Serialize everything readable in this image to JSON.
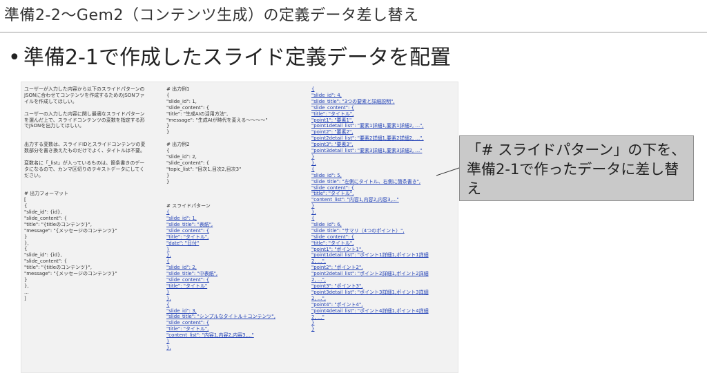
{
  "header": {
    "title": "準備2-2〜Gem2（コンテンツ生成）の定義データ差し替え"
  },
  "bullet": {
    "marker": "•",
    "text": "準備2-1で作成したスライド定義データを配置"
  },
  "document": {
    "col1": [
      "ユーザーが入力した内容から以下のスライドパターンの",
      "JSONに合わせてコンテンツを作成するためのJSONファ",
      "イルを作成してほしい。",
      "",
      "ユーザーの入力した内容に関し最適なスライドパターン",
      "を選んだ上で、スライドコンテンツの変数を指定する形",
      "でJSONを出力してほしい。",
      "",
      "",
      "出力する変数は、スライドIDとスライドコンテンツの変",
      "数部分を書き換えたものだけでよく、タイトルは不要。",
      "",
      "変数名に「_list」が入っているものは、箇条書きのデー",
      "タになるので、カンマ区切りのテキストデータにしてく",
      "ださい。",
      "",
      "",
      "# 出力フォーマット",
      "[",
      "{",
      "\"slide_id\": {id},",
      "\"slide_content\": {",
      "\"title\": \"{titleのコンテンツ}\",",
      "\"message\": \"{メッセージのコンテンツ}\"",
      "}",
      "},",
      "{",
      "\"slide_id\": {id},",
      "\"slide_content\": {",
      "\"title\": \"{titleのコンテンツ}\",",
      "\"message\": \"{メッセージのコンテンツ}\"",
      "}",
      "},",
      "...",
      "]"
    ],
    "col2": [
      "# 出力例1",
      "{",
      "\"slide_id\": 1,",
      "\"slide_content\": {",
      "\"title\": \"生成AIの活用方法\",",
      "\"message\": \"生成AIが時代を変える〜〜〜〜\"",
      "}",
      "}",
      "",
      "# 出力例2",
      "{",
      "\"slide_id\": 2,",
      "\"slide_content\": {",
      "\"topic_list\": \"目次1,目次2,目次3\"",
      "}",
      "}",
      "",
      "",
      "",
      "# スライドパターン",
      "{",
      "\"slide_id\": 1,",
      "\"slide_title\": \"表紙\",",
      "\"slide_content\": {",
      "\"title\": \"タイトル\",",
      "\"date\": \"日付\"",
      "}",
      "},",
      "{",
      "\"slide_id\": 2,",
      "\"slide_title\": \"中表紙\",",
      "\"slide_content\": {",
      "\"title\": \"タイトル\"",
      "}",
      "},",
      "{",
      "\"slide_id\": 3,",
      "\"slide_title\": \"シンプルなタイトル＋コンテンツ\",",
      "\"slide_content\": {",
      "\"title\": \"タイトル\",",
      "\"content_list\": \"内容1,内容2,内容3,...\"",
      "}",
      "},"
    ],
    "col3": [
      "{",
      "\"slide_id\": 4,",
      "\"slide_title\": \"3つの要素と詳細説明\",",
      "\"slide_content\": {",
      "\"title\": \"タイトル\",",
      "\"point1\": \"要素1\",",
      "\"point1detail_list\": \"要素1詳細1,要素1詳細2, ...\",",
      "\"point2\": \"要素2\",",
      "\"point2detail_list\": \"要素2詳細1,要素2詳細2, ...\",",
      "\"point3\": \"要素3\",",
      "\"point3detail_list\": \"要素3詳細1,要素3詳細2, ...\"",
      "}",
      "},",
      "{",
      "\"slide_id\": 5,",
      "\"slide_title\": \"左側にタイトル、右側に箇条書き\",",
      "\"slide_content\": {",
      "\"title\": \"タイトル\",",
      "\"content_list\": \"内容1,内容2,内容3,...\"",
      "}",
      "},",
      "{",
      "\"slide_id\": 6,",
      "\"slide_title\": \"サマリ（4つのポイント）\",",
      "\"slide_content\": {",
      "\"title\": \"タイトル\",",
      "\"point1\": \"ポイント1\",",
      "\"point1detail_list\": \"ポイント1詳細1,ポイント1詳細",
      "2, ...\",",
      "\"point2\": \"ポイント2\",",
      "\"point2detail_list\": \"ポイント2詳細1,ポイント2詳細",
      "2, ...\",",
      "\"point3\": \"ポイント3\",",
      "\"point3detail_list\": \"ポイント3詳細1,ポイント3詳細",
      "2, ...\",",
      "\"point4\": \"ポイント4\",",
      "\"point4detail_list\": \"ポイント4詳細1,ポイント4詳細",
      "2, ...\"",
      "}",
      "}"
    ]
  },
  "callout": {
    "text": "「# スライドパターン」の下を、準備2-1で作ったデータに差し替え"
  }
}
